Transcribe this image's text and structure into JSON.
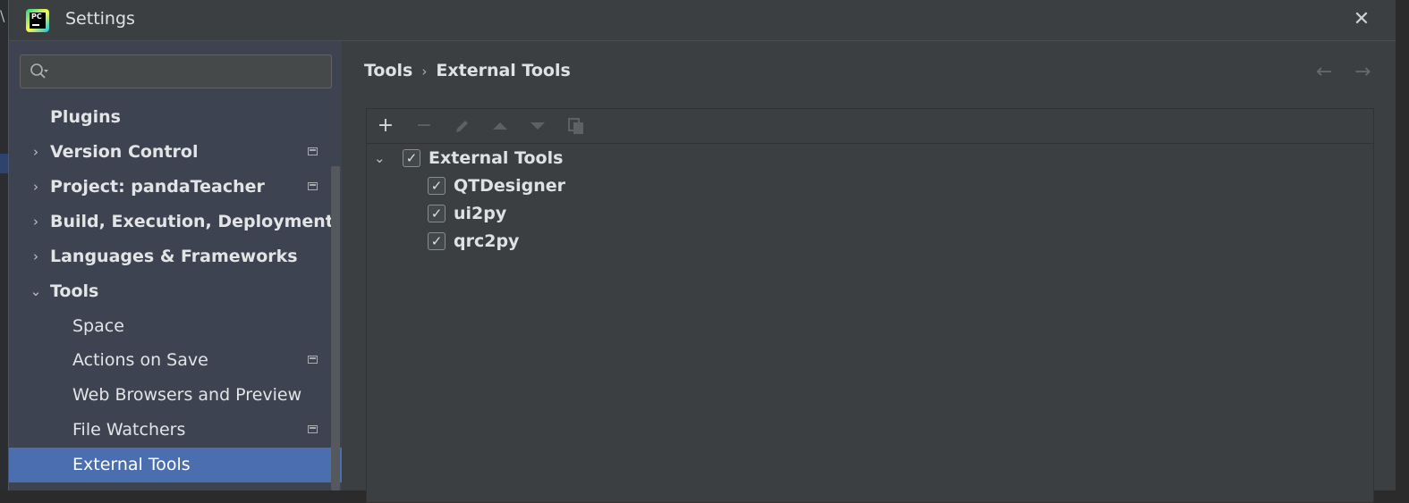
{
  "window": {
    "title": "Settings",
    "app_icon": "pycharm-logo-icon",
    "close_icon": "close-icon"
  },
  "search": {
    "value": "",
    "placeholder": ""
  },
  "sidebar": {
    "items": [
      {
        "label": "Plugins",
        "bold": true,
        "expandable": false,
        "has_project_icon": false
      },
      {
        "label": "Version Control",
        "bold": true,
        "expandable": true,
        "expanded": false,
        "has_project_icon": true
      },
      {
        "label": "Project: pandaTeacher",
        "bold": true,
        "expandable": true,
        "expanded": false,
        "has_project_icon": true
      },
      {
        "label": "Build, Execution, Deployment",
        "bold": true,
        "expandable": true,
        "expanded": false,
        "has_project_icon": false
      },
      {
        "label": "Languages & Frameworks",
        "bold": true,
        "expandable": true,
        "expanded": false,
        "has_project_icon": false
      },
      {
        "label": "Tools",
        "bold": true,
        "expandable": true,
        "expanded": true,
        "has_project_icon": false
      },
      {
        "label": "Space",
        "bold": false,
        "expandable": false,
        "has_project_icon": false
      },
      {
        "label": "Actions on Save",
        "bold": false,
        "expandable": false,
        "has_project_icon": true
      },
      {
        "label": "Web Browsers and Preview",
        "bold": false,
        "expandable": false,
        "has_project_icon": false
      },
      {
        "label": "File Watchers",
        "bold": false,
        "expandable": false,
        "has_project_icon": true
      },
      {
        "label": "External Tools",
        "bold": false,
        "expandable": false,
        "has_project_icon": false,
        "selected": true
      }
    ]
  },
  "breadcrumb": {
    "parent": "Tools",
    "current": "External Tools",
    "separator": "›"
  },
  "nav": {
    "back": "←",
    "forward": "→"
  },
  "toolbar": {
    "add": "+",
    "remove": "−",
    "edit_icon": "pencil-icon",
    "up_icon": "move-up-icon",
    "down_icon": "move-down-icon",
    "copy_icon": "copy-icon"
  },
  "tools_tree": {
    "group": {
      "label": "External Tools",
      "checked": true,
      "expanded": true
    },
    "items": [
      {
        "label": "QTDesigner",
        "checked": true
      },
      {
        "label": "ui2py",
        "checked": true
      },
      {
        "label": "qrc2py",
        "checked": true
      }
    ]
  },
  "colors": {
    "selection": "#4b6eaf",
    "sidebar_bg": "#3d4350",
    "dialog_bg": "#3c3f41"
  }
}
